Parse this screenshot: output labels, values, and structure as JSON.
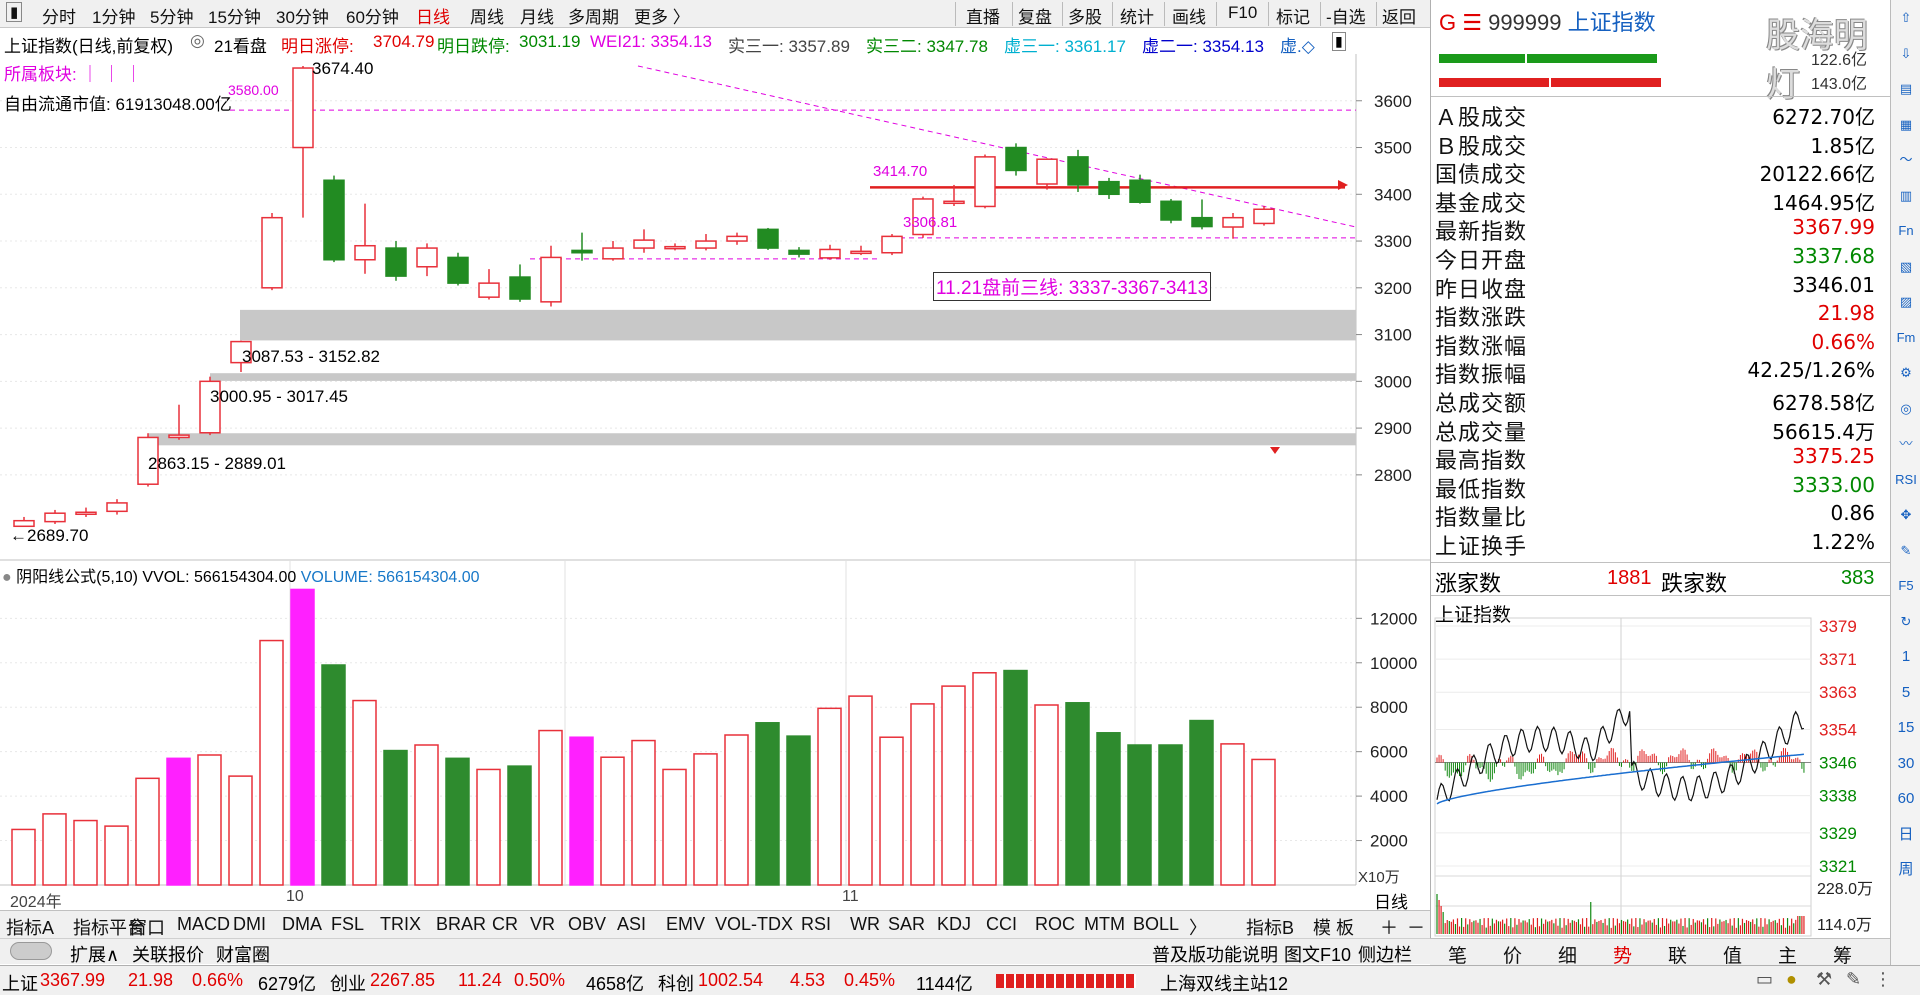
{
  "toolbar": {
    "left_items": [
      "分时",
      "1分钟",
      "5分钟",
      "15分钟",
      "30分钟",
      "60分钟",
      "日线",
      "周线",
      "月线",
      "多周期",
      "更多 〉"
    ],
    "active": "日线",
    "right_items": [
      "直播",
      "复盘",
      "多股",
      "统计",
      "画线",
      "F10",
      "标记",
      "-自选",
      "返回"
    ]
  },
  "chart_header": {
    "title": "上证指数(日线,前复权)",
    "count_label": "21看盘",
    "up_limit_label": "明日涨停:",
    "up_limit": "3704.79",
    "down_limit_label": "明日跌停:",
    "down_limit": "3031.19",
    "wei21": "WEI21: 3354.13",
    "shi31": "实三一: 3357.89",
    "shi32": "实三二: 3347.78",
    "xu31": "虚三一: 3361.17",
    "xu21": "虚二一: 3354.13",
    "xu_more": "虚.◇",
    "sector_label": "所属板块: ｜ ｜ ｜",
    "float_cap": "自由流通市值: 61913048.00亿"
  },
  "annotations": {
    "high": "3674.40",
    "level_3580": "3580.00",
    "level_3414": "3414.70",
    "level_3306": "3306.81",
    "premarket_box": "11.21盘前三线: 3337-3367-3413",
    "zone1": "3087.53 - 3152.82",
    "zone2": "3000.95 - 3017.45",
    "zone3": "2863.15 - 2889.01",
    "low": "2689.70"
  },
  "price_axis": [
    "3600",
    "3500",
    "3400",
    "3300",
    "3200",
    "3100",
    "3000",
    "2900",
    "2800"
  ],
  "volume_header": {
    "formula": "阴阳线公式(5,10)",
    "vvol": "VVOL: 566154304.00",
    "volume": "VOLUME: 566154304.00"
  },
  "volume_axis": [
    "12000",
    "10000",
    "8000",
    "6000",
    "4000",
    "2000"
  ],
  "volume_unit": "X10万",
  "period_label": "日线",
  "date_labels": {
    "year": "2024年",
    "m10": "10",
    "m11": "11"
  },
  "chart_data": {
    "type": "candlestick",
    "candles": [
      {
        "o": 2690,
        "c": 2702,
        "h": 2710,
        "l": 2689.7,
        "vol": 2500
      },
      {
        "o": 2700,
        "c": 2718,
        "h": 2725,
        "l": 2695,
        "vol": 3200
      },
      {
        "o": 2718,
        "c": 2720,
        "h": 2730,
        "l": 2710,
        "vol": 2900
      },
      {
        "o": 2722,
        "c": 2740,
        "h": 2748,
        "l": 2715,
        "vol": 2650
      },
      {
        "o": 2780,
        "c": 2880,
        "h": 2889,
        "l": 2775,
        "vol": 4800
      },
      {
        "o": 2880,
        "c": 2885,
        "h": 2950,
        "l": 2875,
        "vol": 5700
      },
      {
        "o": 2890,
        "c": 3000,
        "h": 3010,
        "l": 2885,
        "vol": 5850
      },
      {
        "o": 3040,
        "c": 3085,
        "h": 3087,
        "l": 3020,
        "vol": 4900
      },
      {
        "o": 3200,
        "c": 3350,
        "h": 3360,
        "l": 3195,
        "vol": 11000
      },
      {
        "o": 3500,
        "c": 3670,
        "h": 3674.4,
        "l": 3350,
        "vol": 13300
      },
      {
        "o": 3430,
        "c": 3260,
        "h": 3440,
        "l": 3255,
        "vol": 9900
      },
      {
        "o": 3260,
        "c": 3290,
        "h": 3380,
        "l": 3230,
        "vol": 8300
      },
      {
        "o": 3285,
        "c": 3225,
        "h": 3300,
        "l": 3215,
        "vol": 6050
      },
      {
        "o": 3245,
        "c": 3285,
        "h": 3295,
        "l": 3225,
        "vol": 6300
      },
      {
        "o": 3265,
        "c": 3210,
        "h": 3275,
        "l": 3205,
        "vol": 5700
      },
      {
        "o": 3180,
        "c": 3210,
        "h": 3240,
        "l": 3175,
        "vol": 5200
      },
      {
        "o": 3223,
        "c": 3176,
        "h": 3250,
        "l": 3170,
        "vol": 5350
      },
      {
        "o": 3170,
        "c": 3265,
        "h": 3290,
        "l": 3160,
        "vol": 6950
      },
      {
        "o": 3280,
        "c": 3275,
        "h": 3318,
        "l": 3258,
        "vol": 6650
      },
      {
        "o": 3262,
        "c": 3285,
        "h": 3300,
        "l": 3258,
        "vol": 5750
      },
      {
        "o": 3285,
        "c": 3302,
        "h": 3325,
        "l": 3275,
        "vol": 6500
      },
      {
        "o": 3286,
        "c": 3288,
        "h": 3295,
        "l": 3280,
        "vol": 5200
      },
      {
        "o": 3285,
        "c": 3300,
        "h": 3315,
        "l": 3280,
        "vol": 5900
      },
      {
        "o": 3300,
        "c": 3310,
        "h": 3318,
        "l": 3292,
        "vol": 6750
      },
      {
        "o": 3325,
        "c": 3285,
        "h": 3328,
        "l": 3281,
        "vol": 7300
      },
      {
        "o": 3280,
        "c": 3272,
        "h": 3287,
        "l": 3265,
        "vol": 6700
      },
      {
        "o": 3264,
        "c": 3282,
        "h": 3292,
        "l": 3260,
        "vol": 7950
      },
      {
        "o": 3275,
        "c": 3278,
        "h": 3290,
        "l": 3270,
        "vol": 8500
      },
      {
        "o": 3275,
        "c": 3310,
        "h": 3315,
        "l": 3270,
        "vol": 6650
      },
      {
        "o": 3314,
        "c": 3390,
        "h": 3395,
        "l": 3306.81,
        "vol": 8150
      },
      {
        "o": 3383,
        "c": 3385,
        "h": 3420,
        "l": 3375,
        "vol": 8950
      },
      {
        "o": 3374,
        "c": 3480,
        "h": 3485,
        "l": 3370,
        "vol": 9550
      },
      {
        "o": 3500,
        "c": 3451,
        "h": 3509,
        "l": 3440,
        "vol": 9650
      },
      {
        "o": 3422,
        "c": 3475,
        "h": 3477,
        "l": 3410,
        "vol": 8100
      },
      {
        "o": 3480,
        "c": 3420,
        "h": 3495,
        "l": 3405,
        "vol": 8200
      },
      {
        "o": 3427,
        "c": 3400,
        "h": 3435,
        "l": 3390,
        "vol": 6850
      },
      {
        "o": 3430,
        "c": 3383,
        "h": 3442,
        "l": 3380,
        "vol": 6300
      },
      {
        "o": 3385,
        "c": 3345,
        "h": 3390,
        "l": 3338,
        "vol": 6300
      },
      {
        "o": 3350,
        "c": 3331,
        "h": 3389,
        "l": 3325,
        "vol": 7400
      },
      {
        "o": 3330,
        "c": 3350,
        "h": 3360,
        "l": 3305,
        "vol": 6350
      },
      {
        "o": 3337.68,
        "c": 3367.99,
        "h": 3375.25,
        "l": 3333.0,
        "vol": 5650
      }
    ],
    "price_range": [
      2650,
      3700
    ],
    "volume_range": [
      0,
      13500
    ]
  },
  "bottom_tabs": [
    "指标A",
    "指标平台",
    "窗口",
    "MACD",
    "DMI",
    "DMA",
    "FSL",
    "TRIX",
    "BRAR",
    "CR",
    "VR",
    "OBV",
    "ASI",
    "EMV",
    "VOL-TDX",
    "RSI",
    "WR",
    "SAR",
    "KDJ",
    "CCI",
    "ROC",
    "MTM",
    "BOLL",
    "〉",
    "指标B",
    "模 板",
    "＋",
    "－"
  ],
  "bottom_tabs2": [
    "扩展∧",
    "关联报价",
    "财富圈"
  ],
  "bottom_tabs2_right": [
    "普及版功能说明",
    "图文F10",
    "侧边栏 《"
  ],
  "quote_panel": {
    "code_prefix": "G ☰",
    "code": "999999",
    "name": "上证指数",
    "watermark": "股海明灯",
    "top_small_1": "122.6亿",
    "top_small_2": "143.0亿",
    "rows": [
      {
        "label": "Ａ股成交",
        "value": "6272.70亿",
        "color": "#000"
      },
      {
        "label": "Ｂ股成交",
        "value": "1.85亿",
        "color": "#000"
      },
      {
        "label": "国债成交",
        "value": "20122.66亿",
        "color": "#000"
      },
      {
        "label": "基金成交",
        "value": "1464.95亿",
        "color": "#000"
      },
      {
        "label": "最新指数",
        "value": "3367.99",
        "color": "#e00000"
      },
      {
        "label": "今日开盘",
        "value": "3337.68",
        "color": "#008800"
      },
      {
        "label": "昨日收盘",
        "value": "3346.01",
        "color": "#000"
      },
      {
        "label": "指数涨跌",
        "value": "21.98",
        "color": "#e00000"
      },
      {
        "label": "指数涨幅",
        "value": "0.66%",
        "color": "#e00000"
      },
      {
        "label": "指数振幅",
        "value": "42.25/1.26%",
        "color": "#000"
      },
      {
        "label": "总成交额",
        "value": "6278.58亿",
        "color": "#000"
      },
      {
        "label": "总成交量",
        "value": "56615.4万",
        "color": "#000"
      },
      {
        "label": "最高指数",
        "value": "3375.25",
        "color": "#e00000"
      },
      {
        "label": "最低指数",
        "value": "3333.00",
        "color": "#008800"
      },
      {
        "label": "指数量比",
        "value": "0.86",
        "color": "#000"
      },
      {
        "label": "上证换手",
        "value": "1.22%",
        "color": "#000"
      }
    ],
    "adv_label": "涨家数",
    "adv": "1881",
    "dec_label": "跌家数",
    "dec": "383",
    "mini_title": "上证指数",
    "mini_axis": [
      "3379",
      "3371",
      "3363",
      "3354",
      "3346",
      "3338",
      "3329",
      "3321"
    ],
    "mini_vol_axis": [
      "228.0万",
      "114.0万"
    ],
    "bottom_tabs": [
      "笔",
      "价",
      "细",
      "势",
      "联",
      "值",
      "主",
      "筹"
    ],
    "bottom_active": "势"
  },
  "right_strip": [
    "⇧",
    "⇩",
    "▤",
    "▦",
    "〜",
    "▥",
    "Fn",
    "▧",
    "▨",
    "Fm",
    "⚙",
    "◎",
    "〰",
    "RSI",
    "✥",
    "✎",
    "F5",
    "↻",
    "1",
    "5",
    "15",
    "30",
    "60",
    "日",
    "周"
  ],
  "statusbar": {
    "sh_label": "上证",
    "sh_val": "3367.99",
    "sh_chg": "21.98",
    "sh_pct": "0.66%",
    "sh_amt": "6279亿",
    "cy_label": "创业",
    "cy_val": "2267.85",
    "cy_chg": "11.24",
    "cy_pct": "0.50%",
    "cy_amt": "4658亿",
    "kc_label": "科创",
    "kc_val": "1002.54",
    "kc_chg": "4.53",
    "kc_pct": "0.45%",
    "kc_amt": "1144亿",
    "server": "上海双线主站12"
  }
}
